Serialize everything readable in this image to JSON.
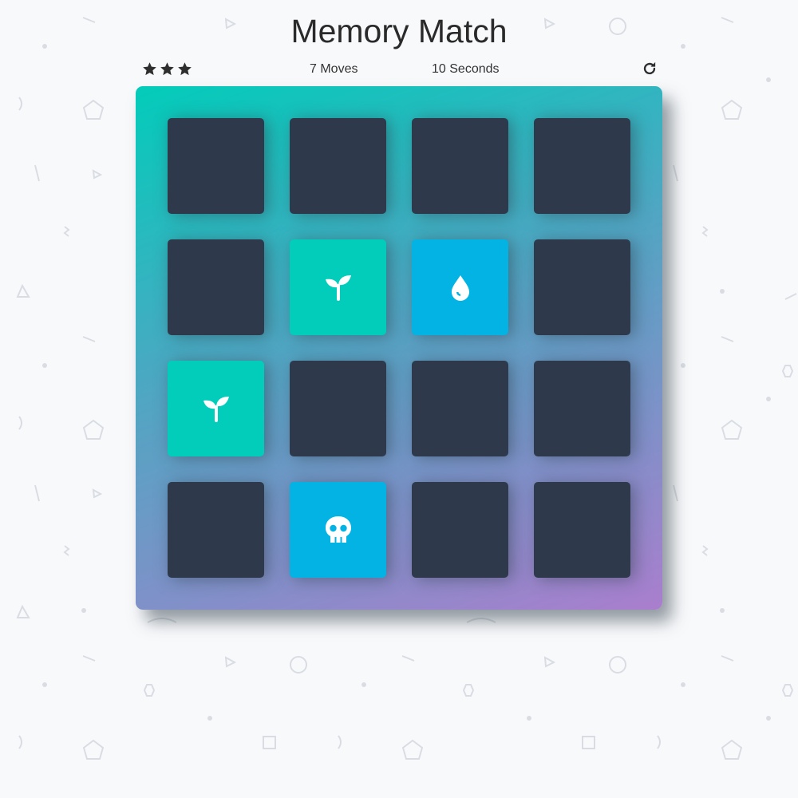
{
  "header": {
    "title": "Memory Match"
  },
  "score_panel": {
    "stars": [
      {
        "icon": "star-icon"
      },
      {
        "icon": "star-icon"
      },
      {
        "icon": "star-icon"
      }
    ],
    "moves_label": "7 Moves",
    "timer_label": "10 Seconds",
    "restart_icon": "restart-icon"
  },
  "colors": {
    "card_back": "#2e3a4b",
    "card_match": "#02ccba",
    "card_open": "#02b3e4",
    "deck_gradient_start": "#02ccba",
    "deck_gradient_end": "#aa7ecd"
  },
  "deck": {
    "rows": [
      [
        {
          "state": "closed",
          "icon": ""
        },
        {
          "state": "closed",
          "icon": ""
        },
        {
          "state": "closed",
          "icon": ""
        },
        {
          "state": "closed",
          "icon": ""
        }
      ],
      [
        {
          "state": "closed",
          "icon": ""
        },
        {
          "state": "match",
          "icon": "seedling-icon"
        },
        {
          "state": "open",
          "icon": "tint-icon"
        },
        {
          "state": "closed",
          "icon": ""
        }
      ],
      [
        {
          "state": "match",
          "icon": "seedling-icon"
        },
        {
          "state": "closed",
          "icon": ""
        },
        {
          "state": "closed",
          "icon": ""
        },
        {
          "state": "closed",
          "icon": ""
        }
      ],
      [
        {
          "state": "closed",
          "icon": ""
        },
        {
          "state": "open",
          "icon": "skull-icon"
        },
        {
          "state": "closed",
          "icon": ""
        },
        {
          "state": "closed",
          "icon": ""
        }
      ]
    ]
  }
}
